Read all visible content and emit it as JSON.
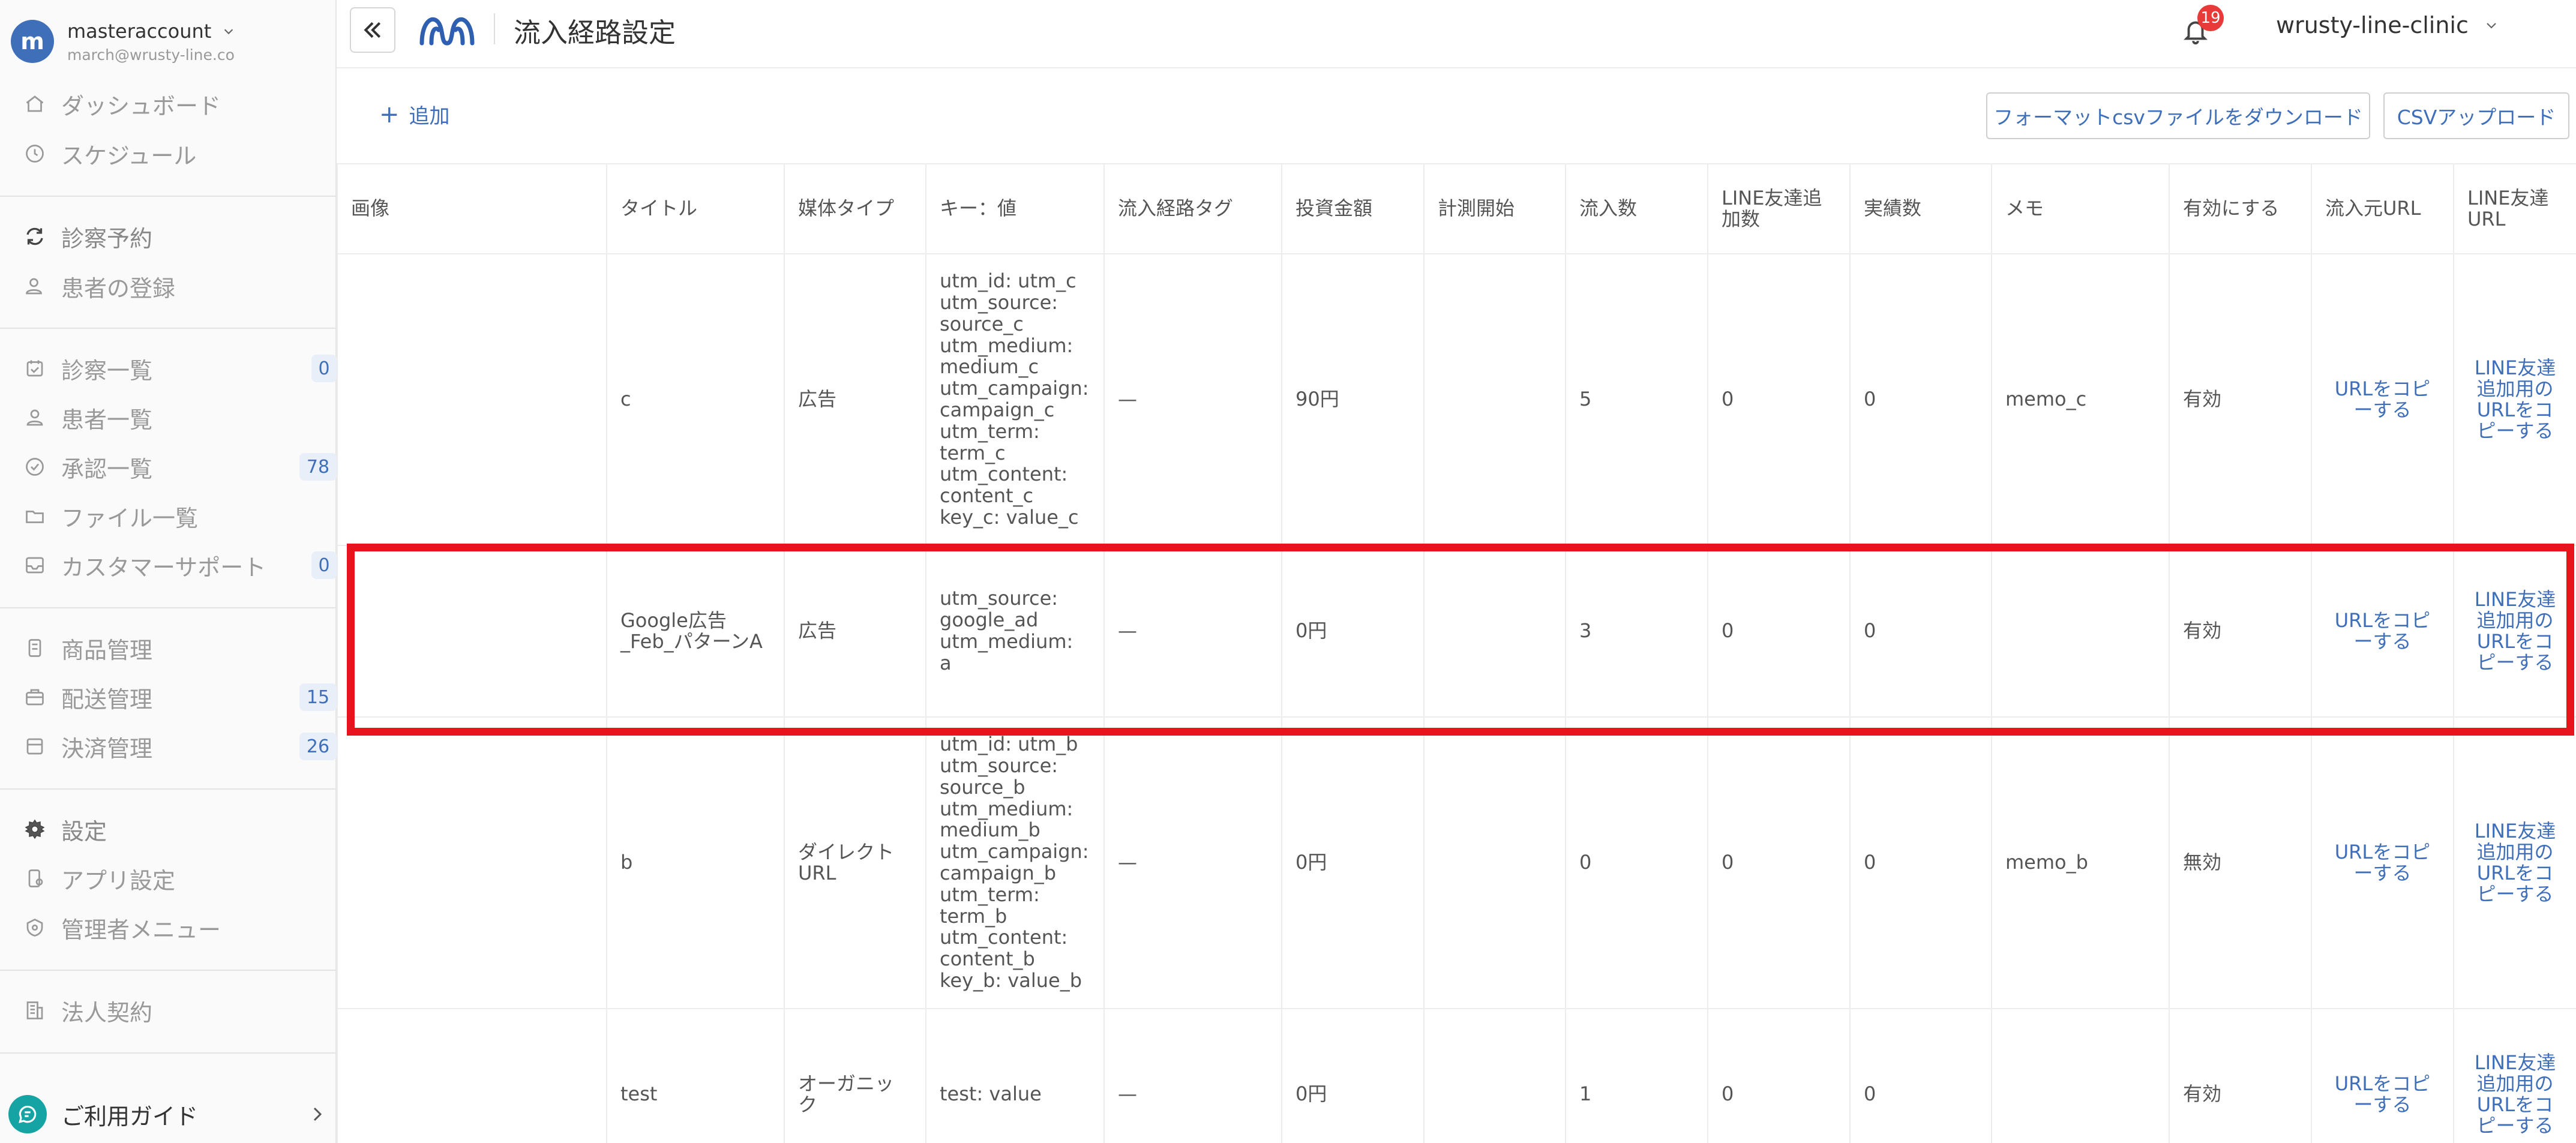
{
  "account": {
    "avatar_letter": "m",
    "name": "masteraccount",
    "email": "march@wrusty-line.co"
  },
  "sidebar": {
    "items": [
      {
        "label": "ダッシュボード",
        "icon": "home-icon"
      },
      {
        "label": "スケジュール",
        "icon": "clock-icon"
      },
      {
        "label": "診察予約",
        "icon": "refresh-calendar-icon"
      },
      {
        "label": "患者の登録",
        "icon": "user-add-icon"
      },
      {
        "label": "診察一覧",
        "icon": "calendar-check-icon",
        "badge": "0"
      },
      {
        "label": "患者一覧",
        "icon": "user-icon"
      },
      {
        "label": "承認一覧",
        "icon": "check-circle-icon",
        "badge": "78"
      },
      {
        "label": "ファイル一覧",
        "icon": "folder-icon"
      },
      {
        "label": "カスタマーサポート",
        "icon": "inbox-icon",
        "badge": "0"
      },
      {
        "label": "商品管理",
        "icon": "box-icon"
      },
      {
        "label": "配送管理",
        "icon": "delivery-icon",
        "badge": "15"
      },
      {
        "label": "決済管理",
        "icon": "wallet-icon",
        "badge": "26"
      },
      {
        "label": "設定",
        "icon": "gear-icon"
      },
      {
        "label": "アプリ設定",
        "icon": "app-settings-icon"
      },
      {
        "label": "管理者メニュー",
        "icon": "admin-shield-icon"
      },
      {
        "label": "法人契約",
        "icon": "building-icon"
      }
    ],
    "guide_label": "ご利用ガイド"
  },
  "header": {
    "title": "流入経路設定",
    "tenant": "wrusty-line-clinic",
    "notification_count": "19"
  },
  "toolbar": {
    "add_label": "追加",
    "download_label": "フォーマットcsvファイルをダウンロード",
    "upload_label": "CSVアップロード"
  },
  "table": {
    "columns": [
      "画像",
      "タイトル",
      "媒体タイプ",
      "キー：値",
      "流入経路タグ",
      "投資金額",
      "計測開始",
      "流入数",
      "LINE友達追加数",
      "実績数",
      "メモ",
      "有効にする",
      "流入元URL",
      "LINE友達URL"
    ],
    "rows": [
      {
        "image": "",
        "title": "c",
        "media": "広告",
        "kv": "utm_id: utm_c\nutm_source:\nsource_c\nutm_medium:\nmedium_c\nutm_campaign:\ncampaign_c\nutm_term:\nterm_c\nutm_content:\ncontent_c\nkey_c: value_c",
        "tag": "—",
        "amount": "90円",
        "start": "",
        "inflow": "5",
        "line_add": "0",
        "result": "0",
        "memo": "memo_c",
        "enabled": "有効",
        "src_url": "URLをコピーする",
        "line_url": "LINE友達追加用のURLをコピーする"
      },
      {
        "image": "",
        "title": "Google広告_Feb_パターンA",
        "media": "広告",
        "kv": "utm_source:\ngoogle_ad\nutm_medium: a",
        "tag": "—",
        "amount": "0円",
        "start": "",
        "inflow": "3",
        "line_add": "0",
        "result": "0",
        "memo": "",
        "enabled": "有効",
        "src_url": "URLをコピーする",
        "line_url": "LINE友達追加用のURLをコピーする"
      },
      {
        "image": "",
        "title": "b",
        "media": "ダイレクトURL",
        "kv": "utm_id: utm_b\nutm_source:\nsource_b\nutm_medium:\nmedium_b\nutm_campaign:\ncampaign_b\nutm_term:\nterm_b\nutm_content:\ncontent_b\nkey_b: value_b",
        "tag": "—",
        "amount": "0円",
        "start": "",
        "inflow": "0",
        "line_add": "0",
        "result": "0",
        "memo": "memo_b",
        "enabled": "無効",
        "src_url": "URLをコピーする",
        "line_url": "LINE友達追加用のURLをコピーする"
      },
      {
        "image": "",
        "title": "test",
        "media": "オーガニック",
        "kv": "test: value",
        "tag": "—",
        "amount": "0円",
        "start": "",
        "inflow": "1",
        "line_add": "0",
        "result": "0",
        "memo": "",
        "enabled": "有効",
        "src_url": "URLをコピーする",
        "line_url": "LINE友達追加用のURLをコピーする"
      }
    ]
  },
  "colors": {
    "accent": "#3f6fb8",
    "highlight": "#e8131b",
    "guide": "#16a3a3",
    "notification": "#e93a3a"
  }
}
